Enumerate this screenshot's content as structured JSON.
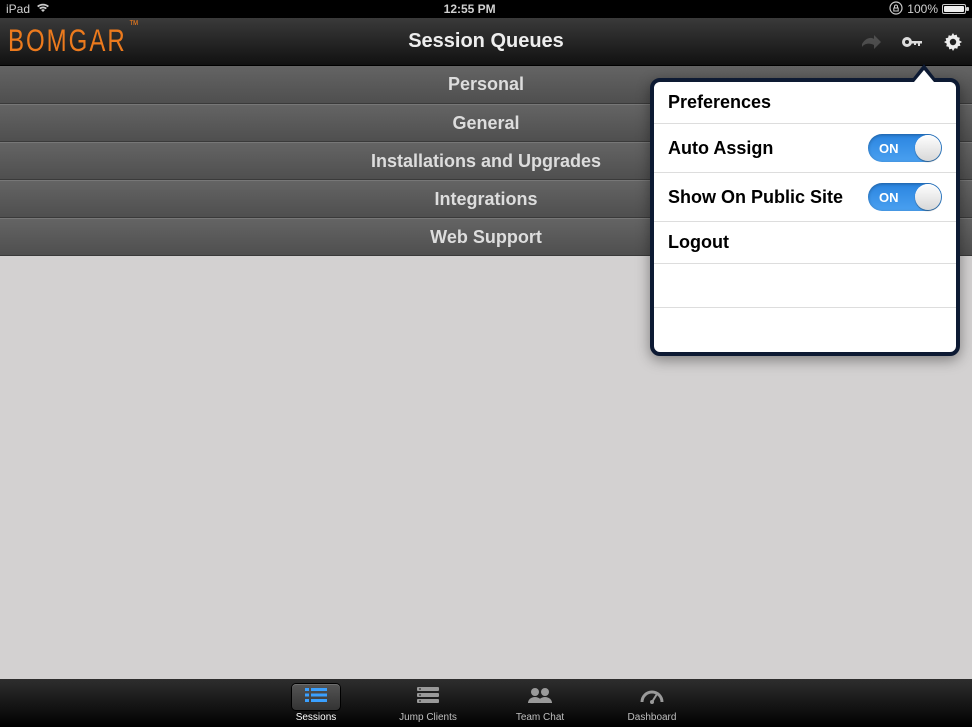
{
  "status": {
    "device": "iPad",
    "time": "12:55 PM",
    "battery_pct": "100%"
  },
  "nav": {
    "brand": "BOMGAR",
    "title": "Session Queues"
  },
  "queues": [
    {
      "label": "Personal"
    },
    {
      "label": "General"
    },
    {
      "label": "Installations and Upgrades"
    },
    {
      "label": "Integrations"
    },
    {
      "label": "Web Support"
    }
  ],
  "popover": {
    "title": "Preferences",
    "auto_assign_label": "Auto Assign",
    "auto_assign_on": "ON",
    "show_public_label": "Show On Public Site",
    "show_public_on": "ON",
    "logout_label": "Logout"
  },
  "tabs": {
    "sessions": "Sessions",
    "jump_clients": "Jump Clients",
    "team_chat": "Team Chat",
    "dashboard": "Dashboard"
  }
}
